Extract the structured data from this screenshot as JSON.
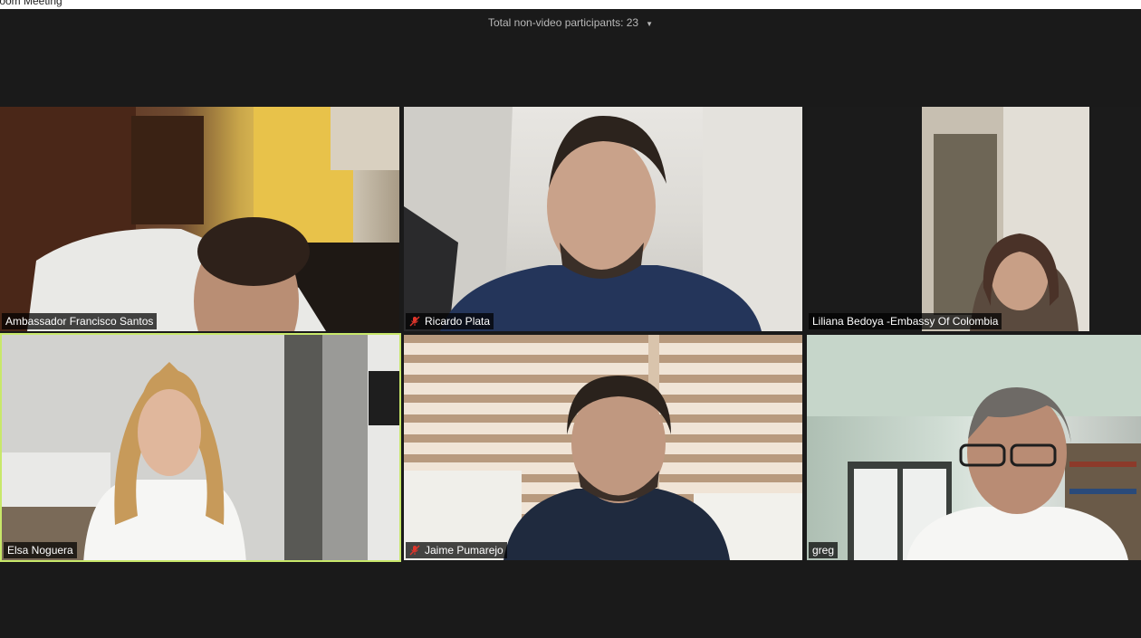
{
  "window": {
    "title": "Zoom Meeting"
  },
  "header": {
    "non_video_label": "Total non-video participants: 23"
  },
  "colors": {
    "active_speaker_border": "#c8e86a",
    "background": "#1a1a1a",
    "muted_icon": "#e0352b"
  },
  "participants": [
    {
      "name": "Ambassador Francisco Santos",
      "muted": false,
      "active": false
    },
    {
      "name": "Ricardo Plata",
      "muted": true,
      "active": false
    },
    {
      "name": "Liliana Bedoya -Embassy Of Colombia",
      "muted": false,
      "active": false
    },
    {
      "name": "Elsa Noguera",
      "muted": false,
      "active": true
    },
    {
      "name": "Jaime Pumarejo",
      "muted": true,
      "active": false
    },
    {
      "name": "greg",
      "muted": false,
      "active": false
    }
  ]
}
